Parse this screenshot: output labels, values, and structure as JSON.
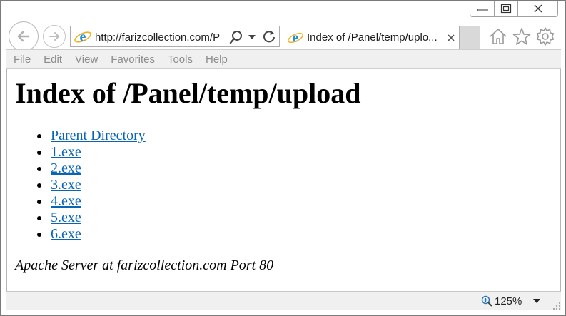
{
  "browser": {
    "address_url": "http://farizcollection.com/P",
    "tab_title": "Index of /Panel/temp/uplo...",
    "menu": [
      "File",
      "Edit",
      "View",
      "Favorites",
      "Tools",
      "Help"
    ],
    "zoom_level": "125%",
    "icons": {
      "back": "back-arrow-icon",
      "forward": "forward-arrow-icon",
      "site": "ie-logo-icon",
      "search": "search-icon",
      "dropdown": "chevron-down-icon",
      "refresh": "refresh-icon",
      "tab_close": "close-icon",
      "home": "home-icon",
      "favorites": "star-icon",
      "settings": "gear-icon",
      "zoom": "zoom-icon"
    },
    "colors": {
      "link": "#0a64b4",
      "ie_logo": "#1e90d8",
      "menu_text": "#8c8c8c",
      "chrome_bg": "#f0f0f0"
    }
  },
  "page": {
    "title": "Index of /Panel/temp/upload",
    "entries": [
      "Parent Directory",
      "1.exe",
      "2.exe",
      "3.exe",
      "4.exe",
      "5.exe",
      "6.exe"
    ],
    "signature": "Apache Server at farizcollection.com Port 80"
  }
}
